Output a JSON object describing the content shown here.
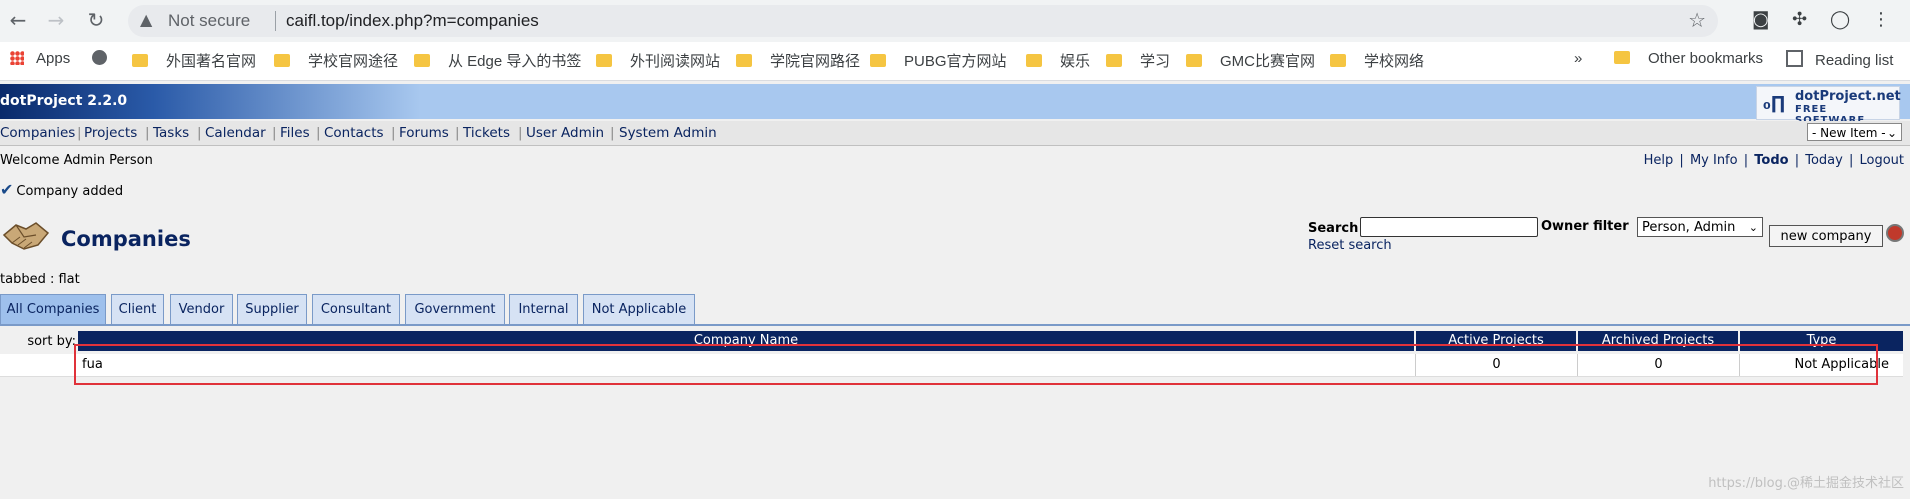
{
  "browser": {
    "url_prefix": "Not secure",
    "url": "caifl.top/index.php?m=companies"
  },
  "bookmarks": {
    "apps": "Apps",
    "items": [
      "外国著名官网",
      "学校官网途径",
      "从 Edge 导入的书签",
      "外刊阅读网站",
      "学院官网路径",
      "PUBG官方网站",
      "娱乐",
      "学习",
      "GMC比赛官网",
      "学校网络"
    ],
    "overflow": "»",
    "other": "Other bookmarks",
    "reading_list": "Reading list"
  },
  "app": {
    "title": "dotProject 2.2.0",
    "logo_line1": "dotProject.net",
    "logo_line2": "FREE SOFTWARE"
  },
  "menu": {
    "items": [
      "Companies",
      "Projects",
      "Tasks",
      "Calendar",
      "Files",
      "Contacts",
      "Forums",
      "Tickets",
      "User Admin",
      "System Admin"
    ],
    "new_item": "- New Item -"
  },
  "user": {
    "welcome": "Welcome Admin Person",
    "links": [
      "Help",
      "My Info",
      "Todo",
      "Today",
      "Logout"
    ]
  },
  "message": "Company added",
  "page": {
    "title": "Companies",
    "search_label": "Search",
    "search_value": "",
    "owner_filter_label": "Owner filter",
    "owner_filter_value": "Person, Admin",
    "new_company_button": "new company",
    "reset_search": "Reset search",
    "tabbed_label": "tabbed : flat"
  },
  "tabs": [
    "All Companies",
    "Client",
    "Vendor",
    "Supplier",
    "Consultant",
    "Government",
    "Internal",
    "Not Applicable"
  ],
  "table": {
    "sort_by": "sort by:",
    "headers": [
      "Company Name",
      "Active Projects",
      "Archived Projects",
      "Type"
    ],
    "rows": [
      {
        "name": "fua",
        "active": "0",
        "archived": "0",
        "type": "Not Applicable"
      }
    ]
  },
  "watermark": "https://blog.@稀土掘金技术社区"
}
